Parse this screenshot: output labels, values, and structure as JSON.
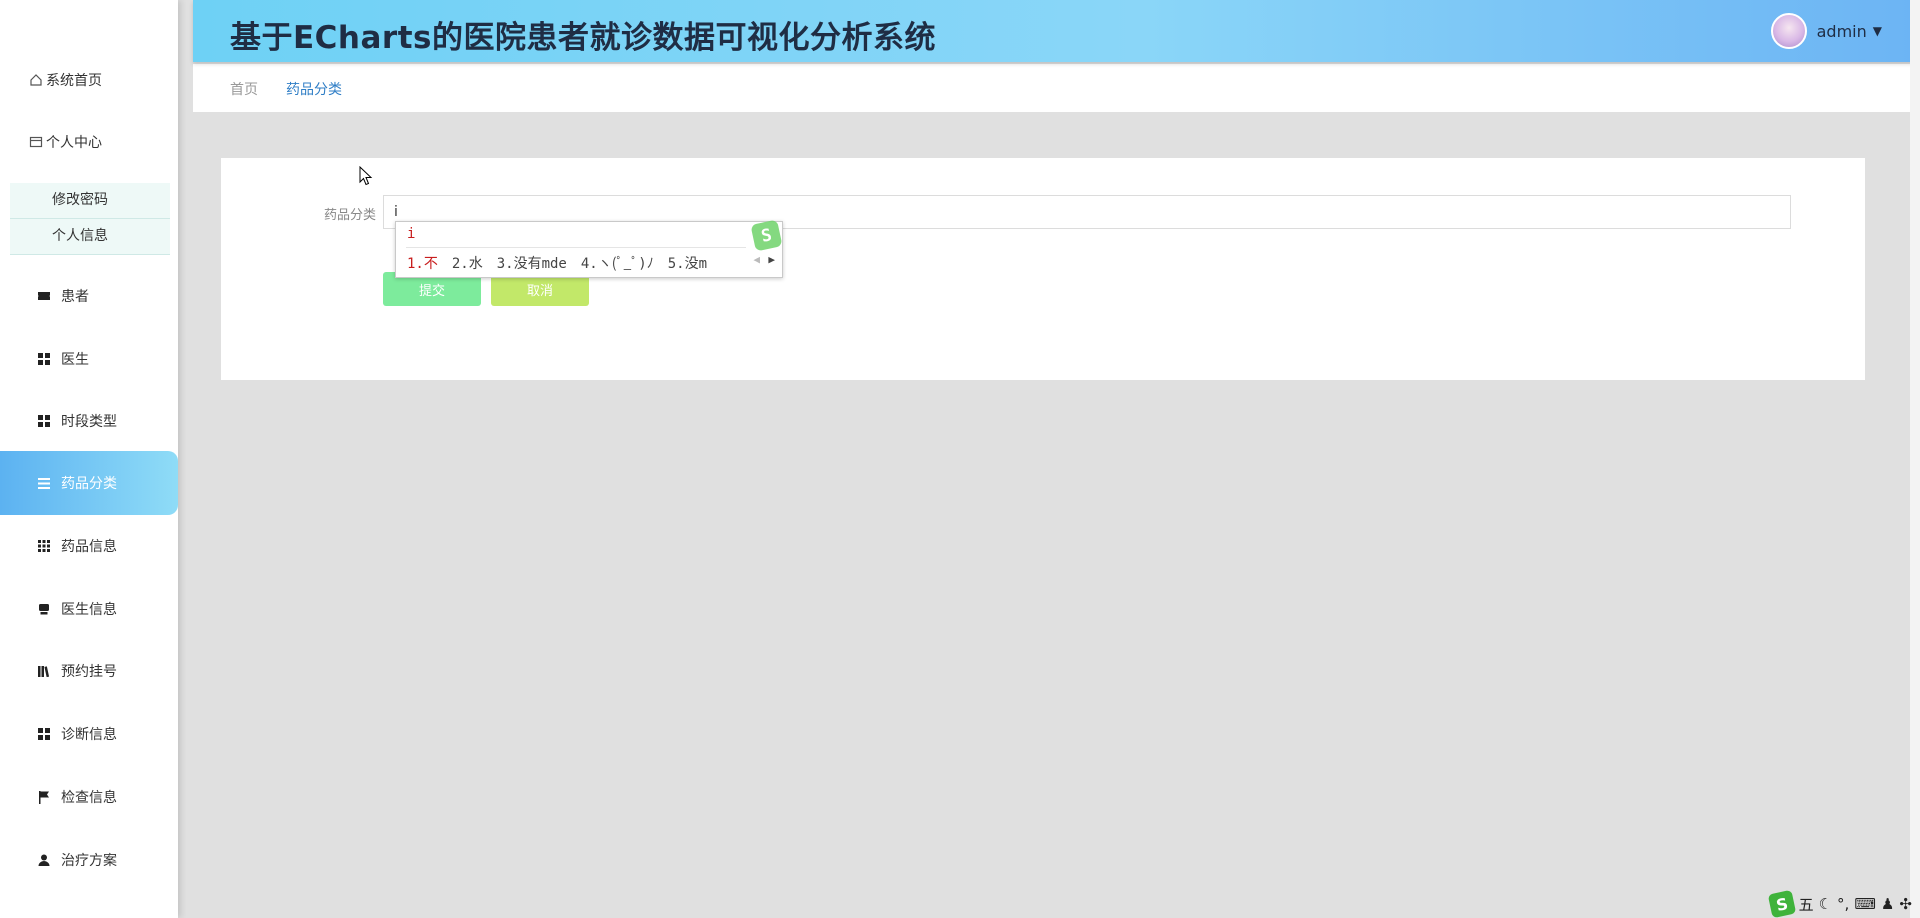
{
  "header": {
    "title": "基于ECharts的医院患者就诊数据可视化分析系统",
    "user": "admin",
    "caret_icon": "caret-down-icon"
  },
  "sidebar": {
    "top_items": [
      {
        "label": "系统首页",
        "icon": "home-icon"
      },
      {
        "label": "个人中心",
        "icon": "user-card-icon"
      }
    ],
    "sub_items": [
      {
        "label": "修改密码"
      },
      {
        "label": "个人信息"
      }
    ],
    "items": [
      {
        "label": "患者",
        "icon": "ticket-icon"
      },
      {
        "label": "医生",
        "icon": "grid-icon"
      },
      {
        "label": "时段类型",
        "icon": "grid-icon"
      },
      {
        "label": "药品分类",
        "icon": "list-icon",
        "active": true
      },
      {
        "label": "药品信息",
        "icon": "apps-icon"
      },
      {
        "label": "医生信息",
        "icon": "print-icon"
      },
      {
        "label": "预约挂号",
        "icon": "library-icon"
      },
      {
        "label": "诊断信息",
        "icon": "grid-icon"
      },
      {
        "label": "检查信息",
        "icon": "flag-icon"
      },
      {
        "label": "治疗方案",
        "icon": "person-icon"
      }
    ]
  },
  "breadcrumb": {
    "home": "首页",
    "current": "药品分类"
  },
  "form": {
    "label": "药品分类",
    "value": "i",
    "submit_label": "提交",
    "cancel_label": "取消"
  },
  "ime": {
    "composition": "i",
    "candidates": [
      "1.不",
      "2.水",
      "3.没有mde",
      "4.ヽ(ﾟ_ﾟ)ﾉ",
      "5.没m"
    ],
    "logo": "S",
    "status": [
      "五",
      "☾",
      "°,",
      "⌨",
      "♟",
      "✣"
    ]
  },
  "colors": {
    "header_start": "#6ed1f5",
    "header_end": "#6cb4f4",
    "active_start": "#5cb2f1",
    "active_end": "#8fdcf7",
    "submit": "#7deb9c",
    "cancel": "#c2e869",
    "link": "#2f7ec6"
  }
}
